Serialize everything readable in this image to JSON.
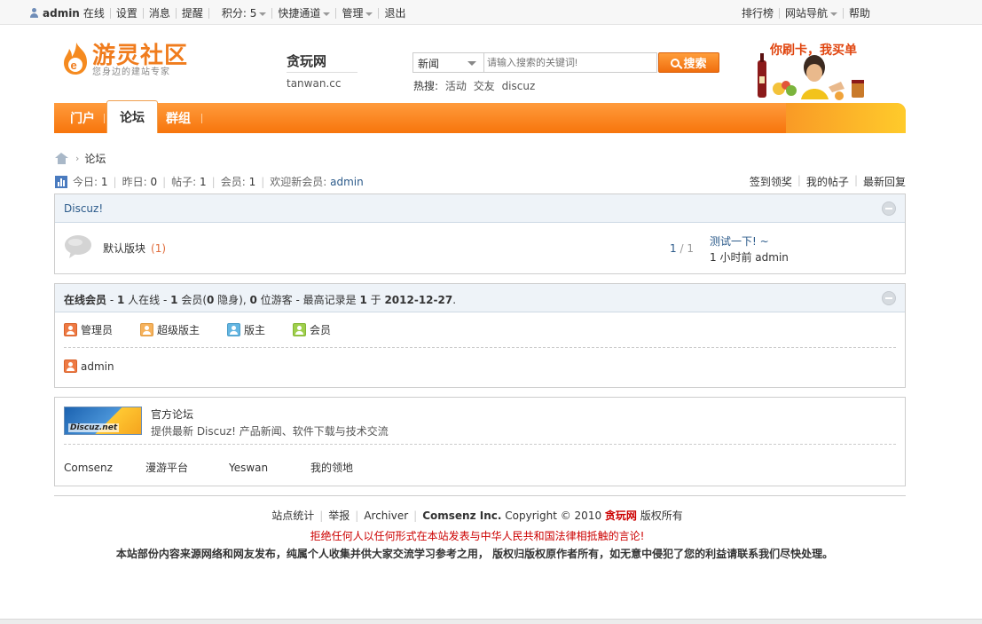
{
  "topbar": {
    "username": "admin",
    "status": "在线",
    "settings": "设置",
    "messages": "消息",
    "reminders": "提醒",
    "points": "积分: 5",
    "quick_access": "快捷通道",
    "manage": "管理",
    "logout": "退出",
    "rankings": "排行榜",
    "site_nav": "网站导航",
    "help": "帮助"
  },
  "logo": {
    "title": "游灵社区",
    "subtitle": "您身边的建站专家"
  },
  "site": {
    "name": "贪玩网",
    "domain": "tanwan.cc"
  },
  "search": {
    "category": "新闻",
    "placeholder": "请输入搜索的关键词!",
    "button": "搜索",
    "hot_label": "热搜:",
    "hot_keywords": [
      "活动",
      "交友",
      "discuz"
    ]
  },
  "ad": {
    "text": "你刷卡，我买单"
  },
  "nav": {
    "tabs": [
      "门户",
      "论坛",
      "群组"
    ],
    "active": "论坛"
  },
  "breadcrumb": {
    "current": "论坛"
  },
  "stats": {
    "today_label": "今日:",
    "today": "1",
    "yesterday_label": "昨日:",
    "yesterday": "0",
    "posts_label": "帖子:",
    "posts": "1",
    "members_label": "会员:",
    "members": "1",
    "welcome_label": "欢迎新会员:",
    "newest_member": "admin"
  },
  "quick_links": [
    "签到领奖",
    "我的帖子",
    "最新回复"
  ],
  "category": {
    "title": "Discuz!",
    "forum_name": "默认版块",
    "forum_count": "(1)",
    "threads": "1",
    "posts": "1",
    "last_post_title": "测试一下! ~",
    "last_post_time": "1 小时前",
    "last_post_author": "admin"
  },
  "online": {
    "label": "在线会员",
    "summary_prefix": "- ",
    "total": "1",
    "summary_mid1": " 人在线  - ",
    "members": "1",
    "summary_mid2": " 会员(",
    "hidden": "0",
    "summary_mid3": " 隐身), ",
    "guests": "0",
    "summary_mid4": " 位游客  - 最高记录是  ",
    "record": "1",
    "summary_mid5": " 于  ",
    "record_date": "2012-12-27",
    "summary_end": ".",
    "legend": [
      "管理员",
      "超级版主",
      "版主",
      "会员"
    ],
    "users": [
      "admin"
    ]
  },
  "friend_links": {
    "logo_text": "Discuz.net",
    "name": "官方论坛",
    "desc": "提供最新 Discuz! 产品新闻、软件下载与技术交流",
    "text_links": [
      "Comsenz",
      "漫游平台",
      "Yeswan",
      "我的领地"
    ]
  },
  "footer": {
    "links": [
      "站点统计",
      "举报",
      "Archiver"
    ],
    "company": "Comsenz Inc.",
    "copyright": "Copyright © 2010",
    "site": "贪玩网",
    "rights": "版权所有",
    "warning": "拒绝任何人以任何形式在本站发表与中华人民共和国法律相抵触的言论!",
    "note": "本站部份内容来源网络和网友发布，纯属个人收集并供大家交流学习参考之用，  版权归版权原作者所有，如无意中侵犯了您的利益请联系我们尽快处理。"
  }
}
